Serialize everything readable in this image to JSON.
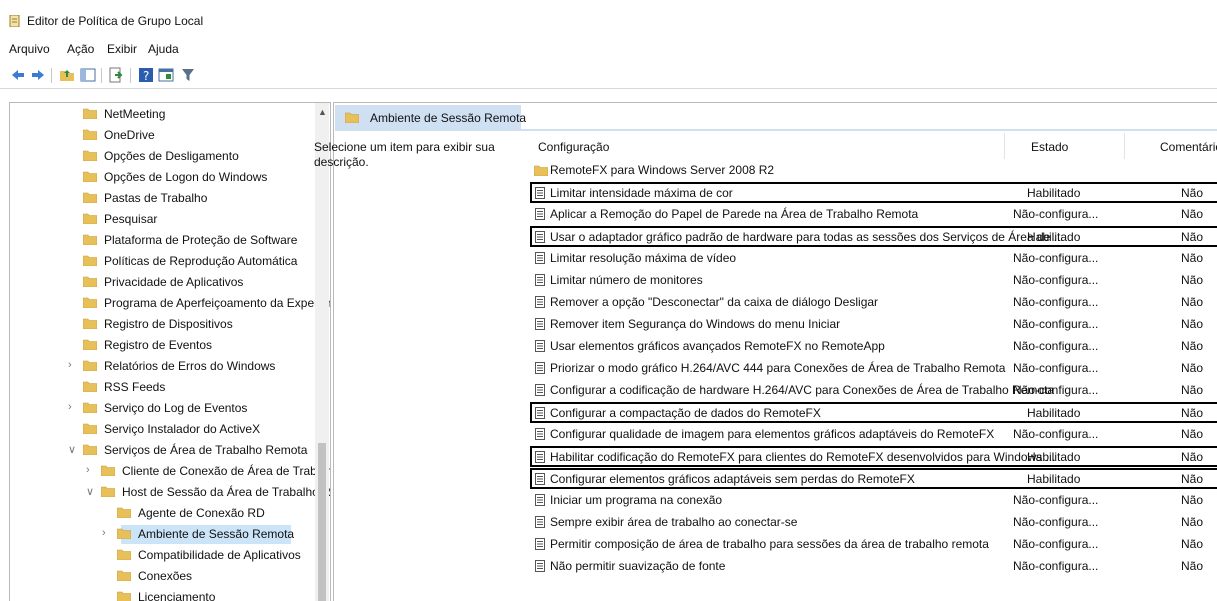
{
  "window": {
    "title": "Editor de Política de Grupo Local"
  },
  "menu": [
    "Arquivo",
    "Ação",
    "Exibir",
    "Ajuda"
  ],
  "toolbar": [
    "back-arrow-icon",
    "forward-arrow-icon",
    "up-folder-icon",
    "show-hide-tree-icon",
    "export-list-icon",
    "help-icon",
    "properties-icon",
    "filter-icon"
  ],
  "tree": {
    "items": [
      {
        "label": "NetMeeting",
        "level": 0,
        "expander": ""
      },
      {
        "label": "OneDrive",
        "level": 0,
        "expander": ""
      },
      {
        "label": "Opções de Desligamento",
        "level": 0,
        "expander": ""
      },
      {
        "label": "Opções de Logon do Windows",
        "level": 0,
        "expander": ""
      },
      {
        "label": "Pastas de Trabalho",
        "level": 0,
        "expander": ""
      },
      {
        "label": "Pesquisar",
        "level": 0,
        "expander": ""
      },
      {
        "label": "Plataforma de Proteção de Software",
        "level": 0,
        "expander": ""
      },
      {
        "label": "Políticas de Reprodução Automática",
        "level": 0,
        "expander": ""
      },
      {
        "label": "Privacidade de Aplicativos",
        "level": 0,
        "expander": ""
      },
      {
        "label": "Programa de Aperfeiçoamento da Experiênc",
        "level": 0,
        "expander": ""
      },
      {
        "label": "Registro de Dispositivos",
        "level": 0,
        "expander": ""
      },
      {
        "label": "Registro de Eventos",
        "level": 0,
        "expander": ""
      },
      {
        "label": "Relatórios de Erros do Windows",
        "level": 0,
        "expander": ">"
      },
      {
        "label": "RSS Feeds",
        "level": 0,
        "expander": ""
      },
      {
        "label": "Serviço do Log de Eventos",
        "level": 0,
        "expander": ">"
      },
      {
        "label": "Serviço Instalador do ActiveX",
        "level": 0,
        "expander": ""
      },
      {
        "label": "Serviços de Área de Trabalho Remota",
        "level": 0,
        "expander": "v"
      },
      {
        "label": "Cliente de Conexão de Área de Trabalho",
        "level": 1,
        "expander": ">"
      },
      {
        "label": "Host de Sessão da Área de Trabalho Rem",
        "level": 1,
        "expander": "v"
      },
      {
        "label": "Agente de Conexão RD",
        "level": 2,
        "expander": ""
      },
      {
        "label": "Ambiente de Sessão Remota",
        "level": 2,
        "expander": ">",
        "selected": true
      },
      {
        "label": "Compatibilidade de Aplicativos",
        "level": 2,
        "expander": ""
      },
      {
        "label": "Conexões",
        "level": 2,
        "expander": ""
      },
      {
        "label": "Licenciamento",
        "level": 2,
        "expander": ""
      }
    ]
  },
  "panel": {
    "title": "Ambiente de Sessão Remota",
    "description": "Selecione um item para exibir sua descrição.",
    "columns": {
      "config": "Configuração",
      "state": "Estado",
      "comment": "Comentário"
    }
  },
  "policies": [
    {
      "name": "RemoteFX para Windows Server 2008 R2",
      "state": "",
      "comment": "",
      "folder": true
    },
    {
      "name": "Limitar intensidade máxima de cor",
      "state": "Habilitado",
      "comment": "Não",
      "boxed": true
    },
    {
      "name": "Aplicar a Remoção do Papel de Parede na Área de Trabalho Remota",
      "state": "Não-configura...",
      "comment": "Não"
    },
    {
      "name": "Usar o adaptador gráfico padrão de hardware para todas as sessões dos Serviços de Área de ...",
      "state": "Habilitado",
      "comment": "Não",
      "boxed": true
    },
    {
      "name": "Limitar resolução máxima de vídeo",
      "state": "Não-configura...",
      "comment": "Não"
    },
    {
      "name": "Limitar número de monitores",
      "state": "Não-configura...",
      "comment": "Não"
    },
    {
      "name": "Remover a opção \"Desconectar\" da caixa de diálogo Desligar",
      "state": "Não-configura...",
      "comment": "Não"
    },
    {
      "name": "Remover item Segurança do Windows do menu Iniciar",
      "state": "Não-configura...",
      "comment": "Não"
    },
    {
      "name": "Usar elementos gráficos avançados RemoteFX no RemoteApp",
      "state": "Não-configura...",
      "comment": "Não"
    },
    {
      "name": "Priorizar o modo gráfico H.264/AVC 444 para Conexões de Área de Trabalho Remota",
      "state": "Não-configura...",
      "comment": "Não"
    },
    {
      "name": "Configurar a codificação de hardware H.264/AVC para Conexões de Área de Trabalho Remota",
      "state": "Não-configura...",
      "comment": "Não"
    },
    {
      "name": "Configurar a compactação de dados do RemoteFX",
      "state": "Habilitado",
      "comment": "Não",
      "boxed": true
    },
    {
      "name": "Configurar qualidade de imagem para elementos gráficos adaptáveis do RemoteFX",
      "state": "Não-configura...",
      "comment": "Não"
    },
    {
      "name": "Habilitar codificação do RemoteFX para clientes do RemoteFX desenvolvidos para Windows ...",
      "state": "Habilitado",
      "comment": "Não",
      "boxed": true
    },
    {
      "name": "Configurar elementos gráficos adaptáveis sem perdas do RemoteFX",
      "state": "Habilitado",
      "comment": "Não",
      "boxed": true
    },
    {
      "name": "Iniciar um programa na conexão",
      "state": "Não-configura...",
      "comment": "Não"
    },
    {
      "name": "Sempre exibir área de trabalho ao conectar-se",
      "state": "Não-configura...",
      "comment": "Não"
    },
    {
      "name": "Permitir composição de área de trabalho para sessões da área de trabalho remota",
      "state": "Não-configura...",
      "comment": "Não"
    },
    {
      "name": "Não permitir suavização de fonte",
      "state": "Não-configura...",
      "comment": "Não"
    }
  ],
  "colors": {
    "selection": "#cce4f7",
    "folder": "#e8c05a",
    "header": "#cfe0f3"
  }
}
